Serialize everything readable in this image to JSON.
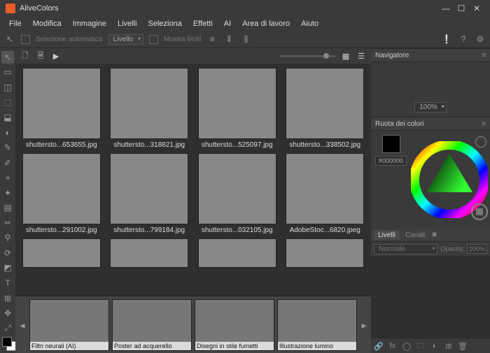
{
  "title": "AliveColors",
  "menu": [
    "File",
    "Modifica",
    "Immagine",
    "Livelli",
    "Seleziona",
    "Effetti",
    "AI",
    "Area di lavoro",
    "Aiuto"
  ],
  "options": {
    "auto_select": "Selezione automatica",
    "level": "Livello",
    "show_bounds": "Mostra limiti"
  },
  "toolbar_tools": [
    "↖",
    "▭",
    "◫",
    "⬚",
    "⬓",
    "◐",
    "✎",
    "✐",
    "⌖",
    "✦",
    "▤",
    "✂",
    "⚲",
    "⟳",
    "◩",
    "T",
    "⊞",
    "✥",
    "⤢"
  ],
  "thumbs": [
    {
      "name": "shuttersto...653655.jpg",
      "scene": "sc-ship"
    },
    {
      "name": "shuttersto...318821.jpg",
      "scene": "sc-woman"
    },
    {
      "name": "shuttersto...525097.jpg",
      "scene": "sc-autumn"
    },
    {
      "name": "shuttersto...338502.jpg",
      "scene": "sc-face"
    },
    {
      "name": "shuttersto...291002.jpg",
      "scene": "sc-beach"
    },
    {
      "name": "shuttersto...799184.jpg",
      "scene": "sc-hair"
    },
    {
      "name": "shuttersto...032105.jpg",
      "scene": "sc-white"
    },
    {
      "name": "AdobeStoc...6820.jpeg",
      "scene": "sc-car"
    },
    {
      "name": "",
      "scene": "sc-bottom1"
    },
    {
      "name": "",
      "scene": "sc-bottom2"
    },
    {
      "name": "",
      "scene": "sc-bottom3"
    },
    {
      "name": "",
      "scene": "sc-bottom4"
    }
  ],
  "filters": [
    {
      "label": "Filtri neurali (AI)",
      "scene": "sc-filter1"
    },
    {
      "label": "Poster ad acquerello",
      "scene": "sc-filter2"
    },
    {
      "label": "Disegni in stile fumetti",
      "scene": "sc-filter3"
    },
    {
      "label": "Illustrazione lumino",
      "scene": "sc-filter4"
    }
  ],
  "panels": {
    "navigator": "Navigatore",
    "zoom": "100%",
    "colorwheel": "Ruota dei colori",
    "hex": "#000000",
    "layers_tab": "Livelli",
    "channels_tab": "Canali",
    "blend": "Normale",
    "opacity_label": "Opacità:",
    "opacity_value": "100%"
  }
}
